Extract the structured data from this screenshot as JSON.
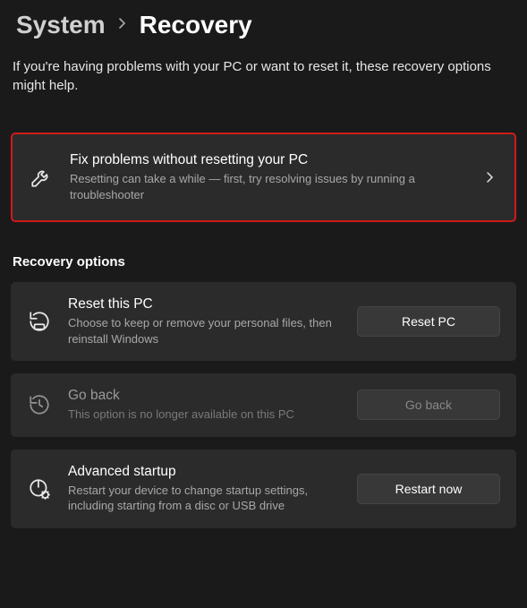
{
  "breadcrumb": {
    "parent": "System",
    "current": "Recovery"
  },
  "description": "If you're having problems with your PC or want to reset it, these recovery options might help.",
  "fix_card": {
    "title": "Fix problems without resetting your PC",
    "subtitle": "Resetting can take a while — first, try resolving issues by running a troubleshooter"
  },
  "section_heading": "Recovery options",
  "reset_card": {
    "title": "Reset this PC",
    "subtitle": "Choose to keep or remove your personal files, then reinstall Windows",
    "button": "Reset PC"
  },
  "goback_card": {
    "title": "Go back",
    "subtitle": "This option is no longer available on this PC",
    "button": "Go back"
  },
  "advanced_card": {
    "title": "Advanced startup",
    "subtitle": "Restart your device to change startup settings, including starting from a disc or USB drive",
    "button": "Restart now"
  }
}
